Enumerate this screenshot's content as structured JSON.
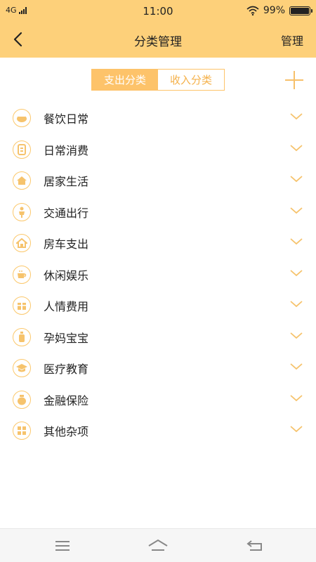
{
  "status_bar": {
    "network": "4G",
    "time": "11:00",
    "battery_percent": "99%",
    "battery_level": 0.99,
    "icons": [
      "signal-icon",
      "wifi-icon",
      "battery-icon"
    ]
  },
  "nav": {
    "title": "分类管理",
    "action_label": "管理",
    "back_icon": "chevron-left-icon"
  },
  "segment": {
    "tabs": [
      {
        "label": "支出分类",
        "active": true
      },
      {
        "label": "收入分类",
        "active": false
      }
    ],
    "add_icon": "plus-icon"
  },
  "categories": [
    {
      "label": "餐饮日常",
      "icon": "food-icon"
    },
    {
      "label": "日常消费",
      "icon": "receipt-icon"
    },
    {
      "label": "居家生活",
      "icon": "house-icon"
    },
    {
      "label": "交通出行",
      "icon": "person-icon"
    },
    {
      "label": "房车支出",
      "icon": "home-car-icon"
    },
    {
      "label": "休闲娱乐",
      "icon": "coffee-icon"
    },
    {
      "label": "人情费用",
      "icon": "gift-icon"
    },
    {
      "label": "孕妈宝宝",
      "icon": "bottle-icon"
    },
    {
      "label": "医疗教育",
      "icon": "graduation-cap-icon"
    },
    {
      "label": "金融保险",
      "icon": "money-bag-icon"
    },
    {
      "label": "其他杂项",
      "icon": "grid-icon"
    }
  ],
  "colors": {
    "header_bg": "#fdd07a",
    "accent": "#fdc36a",
    "accent_text": "#f5b14a",
    "bottom_bar_bg": "#f6f6f6"
  },
  "bottom_bar": {
    "icons": [
      "menu-icon",
      "home-icon",
      "back-icon"
    ]
  }
}
